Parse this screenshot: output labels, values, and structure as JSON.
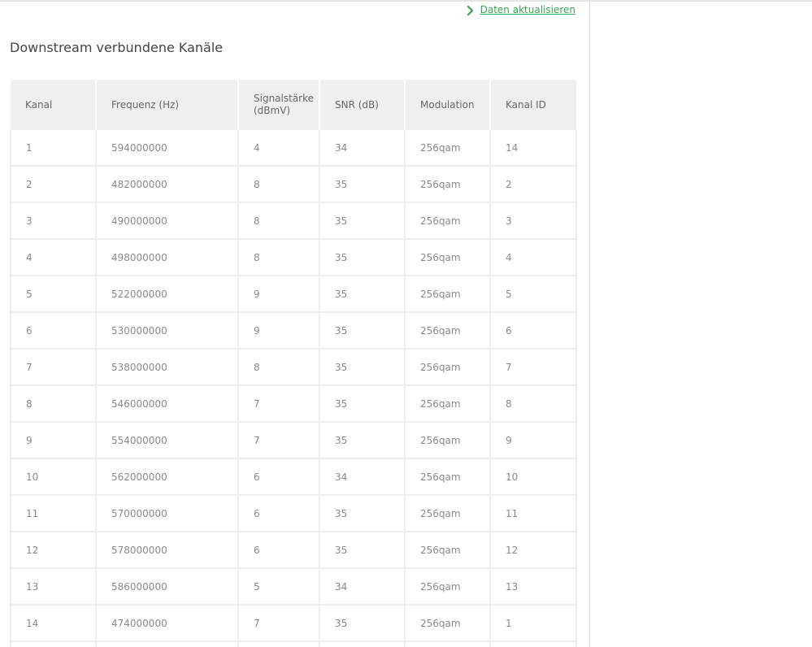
{
  "header": {
    "refresh_link": "Daten aktualisieren",
    "refresh_icon": "chevron-right-icon"
  },
  "section": {
    "title": "Downstream verbundene Kanäle"
  },
  "colors": {
    "accent": "#3aa655",
    "header_bg": "#efefef",
    "border": "#eeeeee"
  },
  "table": {
    "columns": [
      "Kanal",
      "Frequenz (Hz)",
      "Signalstärke (dBmV)",
      "SNR (dB)",
      "Modulation",
      "Kanal ID"
    ],
    "rows": [
      [
        "1",
        "594000000",
        "4",
        "34",
        "256qam",
        "14"
      ],
      [
        "2",
        "482000000",
        "8",
        "35",
        "256qam",
        "2"
      ],
      [
        "3",
        "490000000",
        "8",
        "35",
        "256qam",
        "3"
      ],
      [
        "4",
        "498000000",
        "8",
        "35",
        "256qam",
        "4"
      ],
      [
        "5",
        "522000000",
        "9",
        "35",
        "256qam",
        "5"
      ],
      [
        "6",
        "530000000",
        "9",
        "35",
        "256qam",
        "6"
      ],
      [
        "7",
        "538000000",
        "8",
        "35",
        "256qam",
        "7"
      ],
      [
        "8",
        "546000000",
        "7",
        "35",
        "256qam",
        "8"
      ],
      [
        "9",
        "554000000",
        "7",
        "35",
        "256qam",
        "9"
      ],
      [
        "10",
        "562000000",
        "6",
        "34",
        "256qam",
        "10"
      ],
      [
        "11",
        "570000000",
        "6",
        "35",
        "256qam",
        "11"
      ],
      [
        "12",
        "578000000",
        "6",
        "35",
        "256qam",
        "12"
      ],
      [
        "13",
        "586000000",
        "5",
        "34",
        "256qam",
        "13"
      ],
      [
        "14",
        "474000000",
        "7",
        "35",
        "256qam",
        "1"
      ],
      [
        "",
        "",
        "",
        "",
        "",
        ""
      ]
    ]
  }
}
